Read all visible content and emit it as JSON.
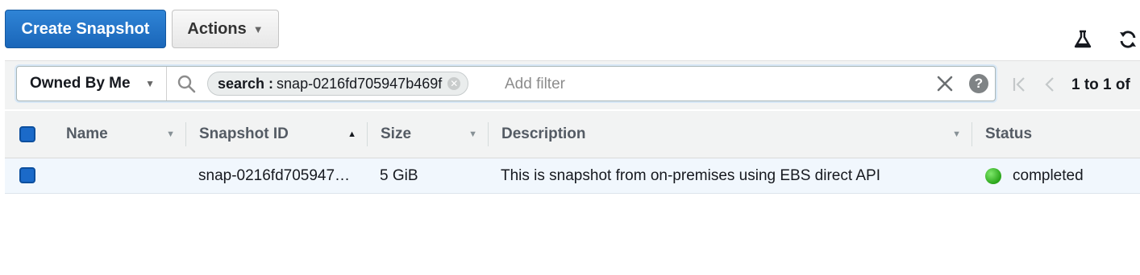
{
  "toolbar": {
    "create_label": "Create Snapshot",
    "actions_label": "Actions",
    "icons": [
      "flask-icon",
      "refresh-icon"
    ]
  },
  "filter": {
    "owner_label": "Owned By Me",
    "token_key": "search :",
    "token_value": "snap-0216fd705947b469f",
    "placeholder": "Add filter"
  },
  "pagination": {
    "text": "1 to 1 of"
  },
  "table": {
    "columns": [
      "Name",
      "Snapshot ID",
      "Size",
      "Description",
      "Status"
    ],
    "rows": [
      {
        "name": "",
        "snapshot_id": "snap-0216fd705947…",
        "size": "5 GiB",
        "description": "This is snapshot from on-premises using EBS direct API",
        "status": "completed"
      }
    ]
  },
  "colors": {
    "primary": "#1a66b9",
    "status_completed": "#2aa51a"
  }
}
